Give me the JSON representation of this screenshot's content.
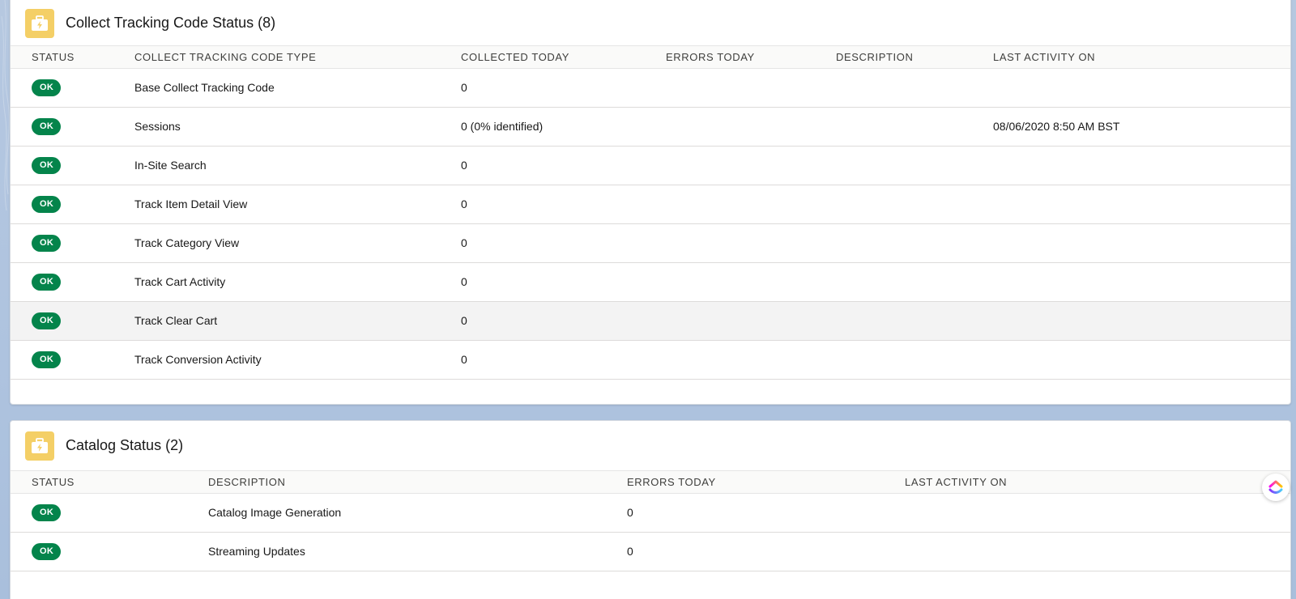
{
  "tracking": {
    "title": "Collect Tracking Code Status (8)",
    "icon": "briefcase-bolt-icon",
    "columns": [
      "STATUS",
      "COLLECT TRACKING CODE TYPE",
      "COLLECTED TODAY",
      "ERRORS TODAY",
      "DESCRIPTION",
      "LAST ACTIVITY ON"
    ],
    "rows": [
      {
        "status": "OK",
        "type": "Base Collect Tracking Code",
        "collected": "0",
        "errors": "",
        "description": "",
        "last_activity": ""
      },
      {
        "status": "OK",
        "type": "Sessions",
        "collected": "0 (0% identified)",
        "errors": "",
        "description": "",
        "last_activity": "08/06/2020 8:50 AM BST"
      },
      {
        "status": "OK",
        "type": "In-Site Search",
        "collected": "0",
        "errors": "",
        "description": "",
        "last_activity": ""
      },
      {
        "status": "OK",
        "type": "Track Item Detail View",
        "collected": "0",
        "errors": "",
        "description": "",
        "last_activity": ""
      },
      {
        "status": "OK",
        "type": "Track Category View",
        "collected": "0",
        "errors": "",
        "description": "",
        "last_activity": ""
      },
      {
        "status": "OK",
        "type": "Track Cart Activity",
        "collected": "0",
        "errors": "",
        "description": "",
        "last_activity": ""
      },
      {
        "status": "OK",
        "type": "Track Clear Cart",
        "collected": "0",
        "errors": "",
        "description": "",
        "last_activity": ""
      },
      {
        "status": "OK",
        "type": "Track Conversion Activity",
        "collected": "0",
        "errors": "",
        "description": "",
        "last_activity": ""
      }
    ]
  },
  "catalog": {
    "title": "Catalog Status (2)",
    "icon": "briefcase-bolt-icon",
    "columns": [
      "STATUS",
      "DESCRIPTION",
      "ERRORS TODAY",
      "LAST ACTIVITY ON"
    ],
    "rows": [
      {
        "status": "OK",
        "description": "Catalog Image Generation",
        "errors": "0",
        "last_activity": ""
      },
      {
        "status": "OK",
        "description": "Streaming Updates",
        "errors": "0",
        "last_activity": ""
      }
    ]
  },
  "colors": {
    "ok_badge": "#04844b",
    "card_icon": "#f4cf66",
    "page_background": "#b0c4df"
  },
  "widget": {
    "icon": "clickup-logo-icon"
  }
}
